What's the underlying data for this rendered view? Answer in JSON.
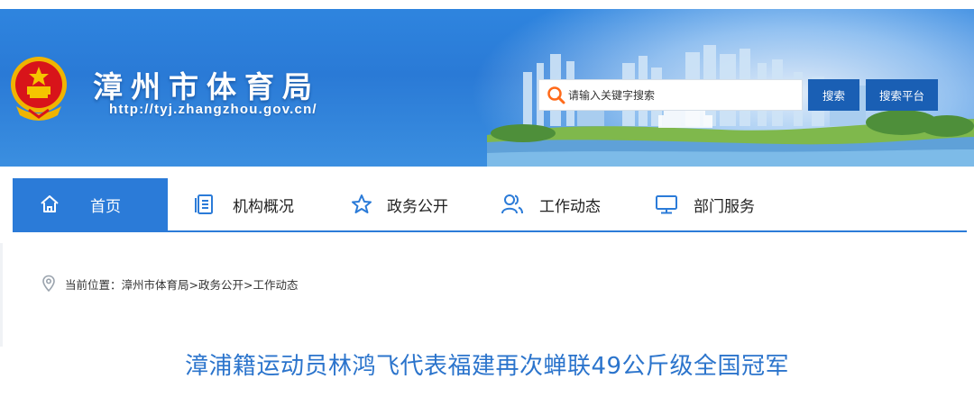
{
  "header": {
    "site_title": "漳州市体育局",
    "site_url": "http://tyj.zhangzhou.gov.cn/",
    "search": {
      "placeholder": "请输入关键字搜索",
      "search_button": "搜索",
      "platform_button": "搜索平台"
    },
    "colors": {
      "banner": "#2f86e0",
      "button": "#1a5fb4"
    }
  },
  "nav": {
    "items": [
      {
        "label": "首页",
        "icon": "home-icon",
        "active": true
      },
      {
        "label": "机构概况",
        "icon": "document-list-icon",
        "active": false
      },
      {
        "label": "政务公开",
        "icon": "star-icon",
        "active": false
      },
      {
        "label": "工作动态",
        "icon": "users-icon",
        "active": false
      },
      {
        "label": "部门服务",
        "icon": "monitor-icon",
        "active": false
      }
    ],
    "accent": "#2b7bd8"
  },
  "breadcrumb": {
    "text": "当前位置：漳州市体育局>政务公开>工作动态",
    "icon": "location-pin-icon"
  },
  "article": {
    "title": "漳浦籍运动员林鸿飞代表福建再次蝉联49公斤级全国冠军",
    "title_color": "#2b74cc"
  }
}
